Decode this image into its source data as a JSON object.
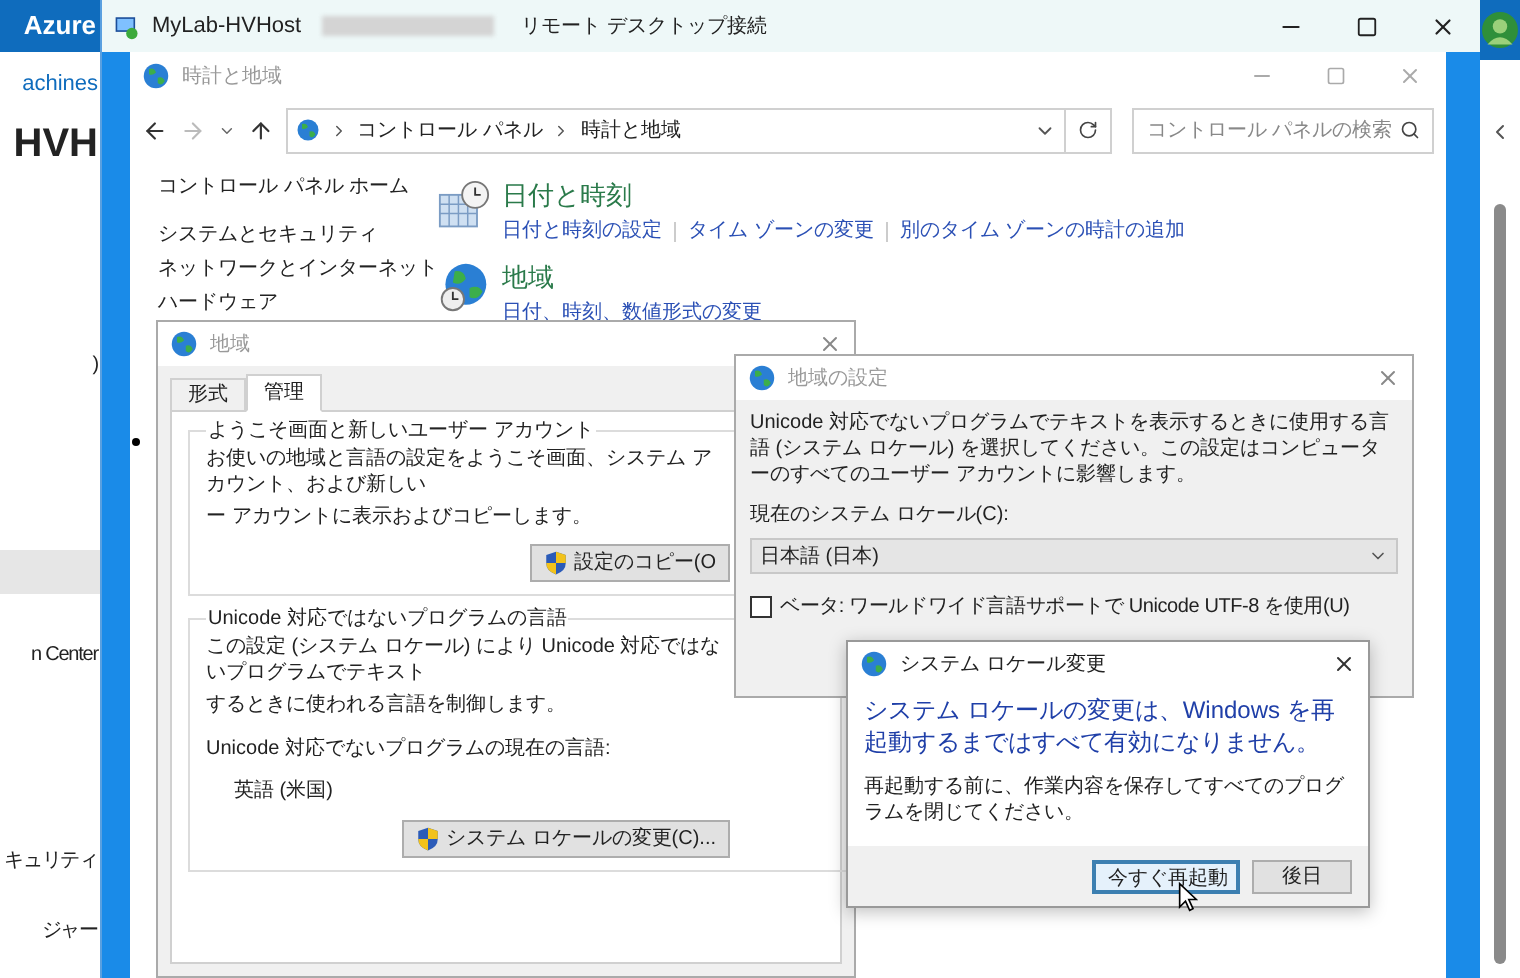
{
  "background_page": {
    "brand": "Azure",
    "items": [
      {
        "text": "achines",
        "kind": "link"
      },
      {
        "text": "HVH",
        "kind": "title"
      },
      {
        "text": ")",
        "kind": "text"
      },
      {
        "text": "n Center",
        "kind": "text"
      },
      {
        "text": "キュリティ",
        "kind": "text"
      },
      {
        "text": "ジャー",
        "kind": "text"
      }
    ]
  },
  "remote_desktop": {
    "host": "MyLab-HVHost",
    "title": "リモート デスクトップ接続"
  },
  "control_panel": {
    "title": "時計と地域",
    "breadcrumb": [
      "コントロール パネル",
      "時計と地域"
    ],
    "search_placeholder": "コントロール パネルの検索",
    "nav": [
      "コントロール パネル ホーム",
      "システムとセキュリティ",
      "ネットワークとインターネット",
      "ハードウェア"
    ],
    "categories": [
      {
        "heading": "日付と時刻",
        "kind": "clock",
        "links": [
          "日付と時刻の設定",
          "タイム ゾーンの変更",
          "別のタイム ゾーンの時計の追加"
        ]
      },
      {
        "heading": "地域",
        "kind": "globe",
        "links": [
          "日付、時刻、数値形式の変更"
        ]
      }
    ]
  },
  "region_dialog": {
    "title": "地域",
    "tabs": [
      {
        "label": "形式",
        "selected": false
      },
      {
        "label": "管理",
        "selected": true
      }
    ],
    "groups": [
      {
        "heading": "ようこそ画面と新しいユーザー アカウント",
        "lines": [
          "お使いの地域と言語の設定をようこそ画面、システム アカウント、および新しい",
          "ー アカウントに表示およびコピーします。"
        ],
        "button": "設定のコピー(O"
      },
      {
        "heading": "Unicode 対応ではないプログラムの言語",
        "lines": [
          "この設定 (システム ロケール) により Unicode 対応ではないプログラムでテキスト",
          "するときに使われる言語を制御します。"
        ],
        "label": "Unicode 対応でないプログラムの現在の言語:",
        "value": "英語 (米国)",
        "button": "システム ロケールの変更(C)..."
      }
    ]
  },
  "region_settings_dialog": {
    "title": "地域の設定",
    "description": "Unicode 対応でないプログラムでテキストを表示するときに使用する言語 (システム ロケール) を選択してください。この設定はコンピューターのすべてのユーザー アカウントに影響します。",
    "locale_label": "現在のシステム ロケール(C):",
    "locale_value": "日本語 (日本)",
    "beta_option": {
      "label": "ベータ: ワールドワイド言語サポートで Unicode UTF-8 を使用(U)",
      "checked": false
    }
  },
  "locale_change_dialog": {
    "title": "システム ロケール変更",
    "heading": "システム ロケールの変更は、Windows を再起動するまではすべて有効になりません。",
    "body": "再起動する前に、作業内容を保存してすべてのプログラムを閉じてください。",
    "buttons": [
      {
        "label": "今すぐ再起動",
        "default": true
      },
      {
        "label": "後日",
        "default": false
      }
    ]
  }
}
